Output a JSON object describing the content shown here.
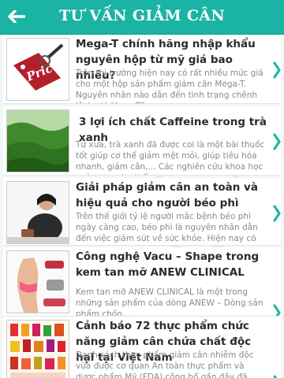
{
  "header": {
    "title": "TƯ VẤN GIẢM CÂN",
    "back_icon": "arrow-left-icon",
    "color": "#1bb3a4"
  },
  "articles": [
    {
      "title": "Mega-T chính hãng nhập khẩu nguyên hộp từ mỹ giá bao nhiêu?",
      "summary": "Trên thị trường hiện nay có rất nhiều mức giá cho một hộp sản phẩm giảm cân Mega-T. Nguyên nhân nào dẫn đến tình trạng chênh lệch giá Mega-T?...",
      "thumb_label": "Price"
    },
    {
      "title": "3 lợi ích chất Caffeine trong trà xanh",
      "summary": "Từ xưa, trà xanh đã được coi là một bài thuốc tốt giúp cơ thể giảm mệt mỏi, giúp tiêu hóa nhanh, giảm cân,... Các nghiên cứu khoa học ngày nay cho thấ...",
      "thumb_label": ""
    },
    {
      "title": "Giải pháp giảm cân an toàn và hiệu quả cho người béo phì",
      "summary": "Trên thế giới tỷ lệ người mắc bệnh béo phì ngày càng cao, béo phì là nguyên nhân dẫn đến việc giảm sút về sức khỏe. Hiện nay có rất nhiều phương ph...",
      "thumb_label": ""
    },
    {
      "title": "Công nghệ Vacu – Shape trong kem tan mỡ ANEW CLINICAL",
      "summary": "Kem tan mỡ ANEW CLINICAL là một trong những sản phẩm của dòng ANEW – Dòng sản phẩm chốn...",
      "thumb_label": ""
    },
    {
      "title": "Cảnh báo 72 thực phẩm chức năng giảm cân chứa chất độc hại tại Việt Nam",
      "summary": "Danh sách thực phẩm giảm cân nhiễm độc vừa được cơ quan An toàn thực phẩm và dược phẩm Mỹ (FDA) công bố gần đây đã cảnh báo người tiêu dùng nên lựa chọn...",
      "thumb_label": ""
    }
  ]
}
